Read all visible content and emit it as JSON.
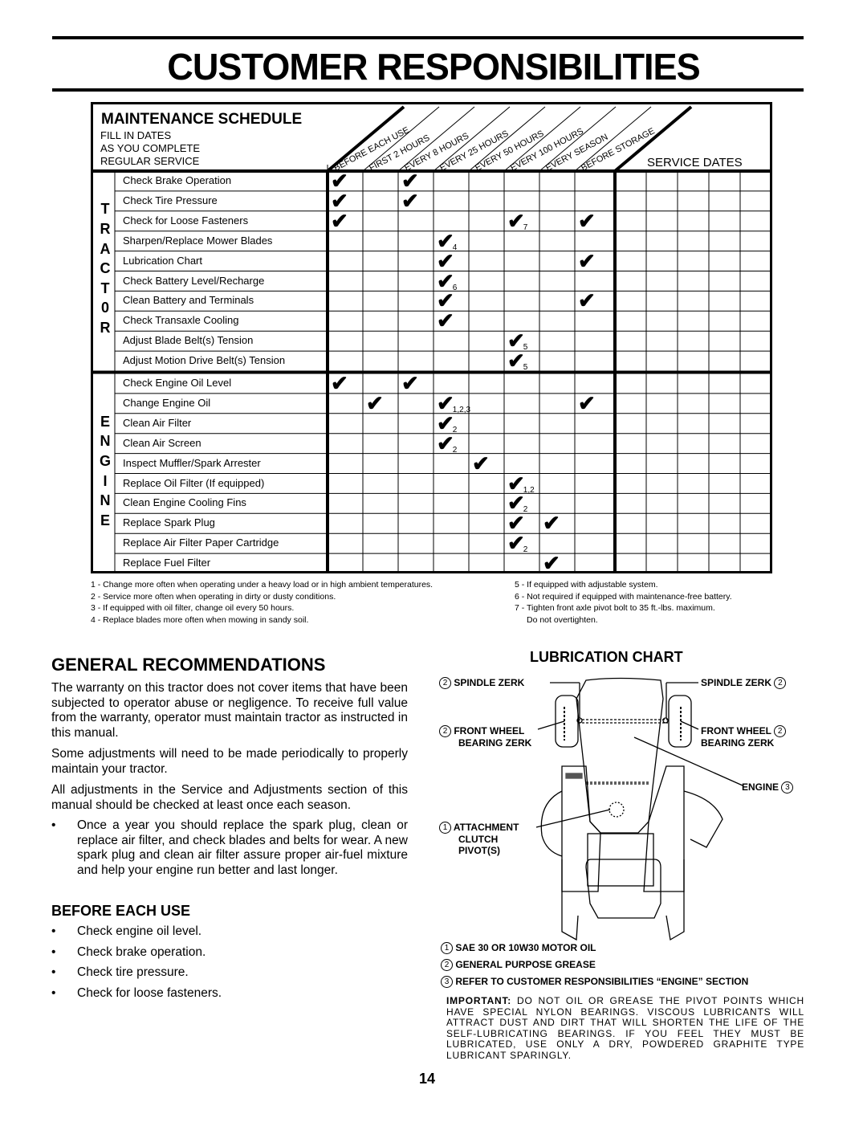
{
  "page": {
    "title": "CUSTOMER RESPONSIBILITIES",
    "page_number": "14"
  },
  "schedule": {
    "title": "MAINTENANCE SCHEDULE",
    "subtitle_lines": [
      "FILL IN DATES",
      "AS YOU COMPLETE",
      "REGULAR SERVICE"
    ],
    "service_dates_label": "SERVICE DATES",
    "service_date_columns": 5,
    "intervals": [
      "BEFORE EACH USE",
      "FIRST 2 HOURS",
      "EVERY 8 HOURS",
      "EVERY 25 HOURS",
      "EVERY 50 HOURS",
      "EVERY 100 HOURS",
      "EVERY SEASON",
      "BEFORE STORAGE"
    ],
    "sections": [
      {
        "name": "TRACTOR",
        "letters": [
          "T",
          "R",
          "A",
          "C",
          "T",
          "0",
          "R"
        ],
        "tasks": [
          {
            "label": "Check Brake Operation",
            "checks": [
              {
                "col": 0,
                "note": ""
              },
              {
                "col": 2,
                "note": ""
              }
            ]
          },
          {
            "label": "Check Tire Pressure",
            "checks": [
              {
                "col": 0,
                "note": ""
              },
              {
                "col": 2,
                "note": ""
              }
            ]
          },
          {
            "label": "Check for Loose Fasteners",
            "checks": [
              {
                "col": 0,
                "note": ""
              },
              {
                "col": 5,
                "note": "7"
              },
              {
                "col": 7,
                "note": ""
              }
            ]
          },
          {
            "label": "Sharpen/Replace Mower Blades",
            "checks": [
              {
                "col": 3,
                "note": "4"
              }
            ]
          },
          {
            "label": "Lubrication Chart",
            "checks": [
              {
                "col": 3,
                "note": ""
              },
              {
                "col": 7,
                "note": ""
              }
            ]
          },
          {
            "label": "Check Battery Level/Recharge",
            "checks": [
              {
                "col": 3,
                "note": "6"
              }
            ]
          },
          {
            "label": "Clean Battery and Terminals",
            "checks": [
              {
                "col": 3,
                "note": ""
              },
              {
                "col": 7,
                "note": ""
              }
            ]
          },
          {
            "label": "Check Transaxle Cooling",
            "checks": [
              {
                "col": 3,
                "note": ""
              }
            ]
          },
          {
            "label": "Adjust Blade Belt(s) Tension",
            "checks": [
              {
                "col": 5,
                "note": "5"
              }
            ]
          },
          {
            "label": "Adjust Motion Drive Belt(s) Tension",
            "checks": [
              {
                "col": 5,
                "note": "5"
              }
            ]
          }
        ]
      },
      {
        "name": "ENGINE",
        "letters": [
          "E",
          "N",
          "G",
          "I",
          "N",
          "E"
        ],
        "tasks": [
          {
            "label": "Check Engine Oil Level",
            "checks": [
              {
                "col": 0,
                "note": ""
              },
              {
                "col": 2,
                "note": ""
              }
            ]
          },
          {
            "label": "Change Engine Oil",
            "checks": [
              {
                "col": 1,
                "note": ""
              },
              {
                "col": 3,
                "note": "1,2,3"
              },
              {
                "col": 7,
                "note": ""
              }
            ]
          },
          {
            "label": "Clean Air Filter",
            "checks": [
              {
                "col": 3,
                "note": "2"
              }
            ]
          },
          {
            "label": "Clean Air Screen",
            "checks": [
              {
                "col": 3,
                "note": "2"
              }
            ]
          },
          {
            "label": "Inspect Muffler/Spark Arrester",
            "checks": [
              {
                "col": 4,
                "note": ""
              }
            ]
          },
          {
            "label": "Replace Oil Filter (If equipped)",
            "checks": [
              {
                "col": 5,
                "note": "1,2"
              }
            ]
          },
          {
            "label": "Clean Engine Cooling Fins",
            "checks": [
              {
                "col": 5,
                "note": "2"
              }
            ]
          },
          {
            "label": "Replace Spark Plug",
            "checks": [
              {
                "col": 5,
                "note": ""
              },
              {
                "col": 6,
                "note": ""
              }
            ]
          },
          {
            "label": "Replace Air Filter Paper Cartridge",
            "checks": [
              {
                "col": 5,
                "note": "2"
              }
            ]
          },
          {
            "label": "Replace Fuel Filter",
            "checks": [
              {
                "col": 6,
                "note": ""
              }
            ]
          }
        ]
      }
    ],
    "check_icon": "check-mark-icon",
    "footnotes_left": [
      "1 - Change more often when operating under a heavy load or in high ambient temperatures.",
      "2 - Service more often when operating in dirty or dusty conditions.",
      "3 - If equipped with oil filter, change oil every 50 hours.",
      "4 - Replace blades more often when mowing in sandy soil."
    ],
    "footnotes_right": [
      "5 - If equipped with adjustable system.",
      "6 - Not required if equipped with maintenance-free battery.",
      "7 - Tighten front axle pivot bolt to 35 ft.-lbs. maximum.",
      "Do not overtighten."
    ]
  },
  "general": {
    "heading": "GENERAL RECOMMENDATIONS",
    "paragraphs": [
      "The warranty on this tractor does not cover items that have been subjected to operator abuse or negligence.  To receive full value from the warranty, operator must maintain tractor as instructed in this manual.",
      "Some adjustments will need to be made periodically to properly maintain your tractor.",
      "All adjustments in the Service and Adjustments section of this manual should be checked at least once each season."
    ],
    "bullet": "Once a year you should replace the spark plug, clean or replace air filter, and check blades and belts for wear.  A new spark plug and clean air filter assure proper air-fuel mixture and help your engine run better and last longer."
  },
  "before_each_use": {
    "heading": "BEFORE EACH USE",
    "items": [
      "Check engine oil level.",
      "Check brake operation.",
      "Check tire pressure.",
      "Check for loose fasteners."
    ]
  },
  "lubrication": {
    "heading": "LUBRICATION CHART",
    "labels": {
      "spindle_left": {
        "num": "2",
        "text": "SPINDLE ZERK"
      },
      "spindle_right": {
        "num": "2",
        "text": "SPINDLE ZERK"
      },
      "wheel_left": {
        "num": "2",
        "line1": "FRONT WHEEL",
        "line2": "BEARING  ZERK"
      },
      "wheel_right": {
        "num": "2",
        "line1": "FRONT WHEEL",
        "line2": "BEARING  ZERK"
      },
      "engine": {
        "num": "3",
        "text": "ENGINE"
      },
      "clutch": {
        "num": "1",
        "line1": "ATTACHMENT",
        "line2": "CLUTCH",
        "line3": "PIVOT(S)"
      }
    },
    "legend": [
      {
        "num": "1",
        "text": "SAE 30 OR 10W30 MOTOR OIL"
      },
      {
        "num": "2",
        "text": "GENERAL PURPOSE GREASE"
      },
      {
        "num": "3",
        "text": "REFER TO CUSTOMER RESPONSIBILITIES “ENGINE” SECTION"
      }
    ],
    "important_label": "IMPORTANT:",
    "important_text": " DO NOT OIL OR GREASE THE PIVOT POINTS WHICH HAVE SPECIAL NYLON BEARINGS.  VISCOUS LUBRICANTS WILL ATTRACT DUST AND DIRT THAT WILL SHORTEN THE LIFE OF THE SELF-LUBRICATING BEARINGS.  IF YOU FEEL THEY MUST BE LUBRICATED, USE ONLY A DRY, POWDERED GRAPHITE TYPE LUBRICANT SPARINGLY."
  }
}
